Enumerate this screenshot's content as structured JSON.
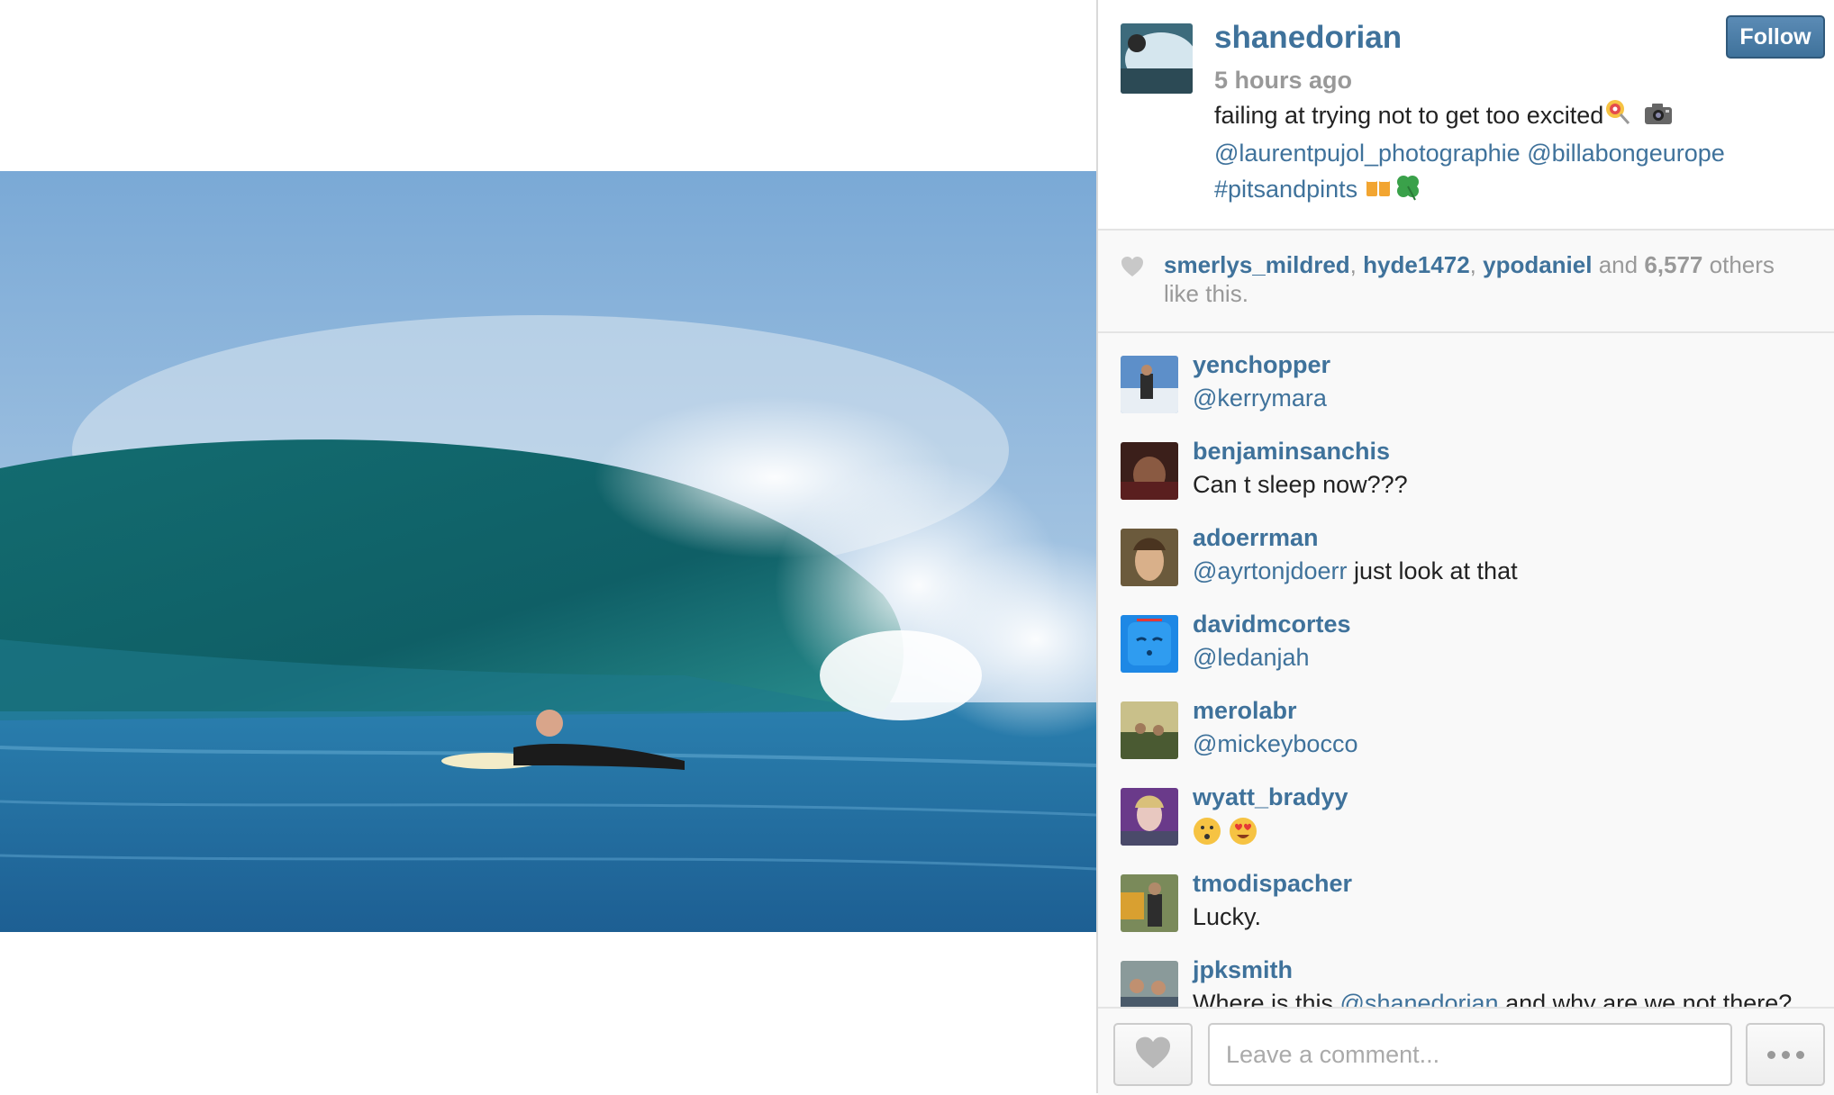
{
  "photo": {
    "subject": "surfer paddling into a large breaking wave"
  },
  "post": {
    "username": "shanedorian",
    "time": "5 hours ago",
    "follow_label": "Follow",
    "caption_text": "failing at trying not to get too excited",
    "caption_tags": [
      "@laurentpujol_photographie",
      "@billabongeurope",
      "#pitsandpints"
    ]
  },
  "likes": {
    "users": [
      "smerlys_mildred",
      "hyde1472",
      "ypodaniel"
    ],
    "joiner": "and",
    "count": "6,577",
    "suffix": "others like this."
  },
  "comments": [
    {
      "user": "yenchopper",
      "mention": "@kerrymara",
      "text": ""
    },
    {
      "user": "benjaminsanchis",
      "mention": "",
      "text": "Can t sleep now???"
    },
    {
      "user": "adoerrman",
      "mention": "@ayrtonjdoerr",
      "text": " just look at that"
    },
    {
      "user": "davidmcortes",
      "mention": "@ledanjah",
      "text": ""
    },
    {
      "user": "merolabr",
      "mention": "@mickeybocco",
      "text": ""
    },
    {
      "user": "wyatt_bradyy",
      "mention": "",
      "text": ""
    },
    {
      "user": "tmodispacher",
      "mention": "",
      "text": "Lucky."
    },
    {
      "user": "jpksmith",
      "text_before": "Where is this ",
      "mention": "@shanedorian",
      "text_after": " and why are we not there?"
    }
  ],
  "footer": {
    "comment_placeholder": "Leave a comment..."
  },
  "colors": {
    "link": "#3f729b",
    "muted": "#999999",
    "panel_bg": "#f9f9f9",
    "follow_bg": "#3f729b"
  },
  "icons": [
    "heart-icon",
    "more-dots-icon",
    "lollipop-emoji",
    "camera-emoji",
    "beer-mugs-emoji",
    "four-leaf-clover-emoji",
    "hushed-face-emoji",
    "heart-eyes-emoji"
  ]
}
